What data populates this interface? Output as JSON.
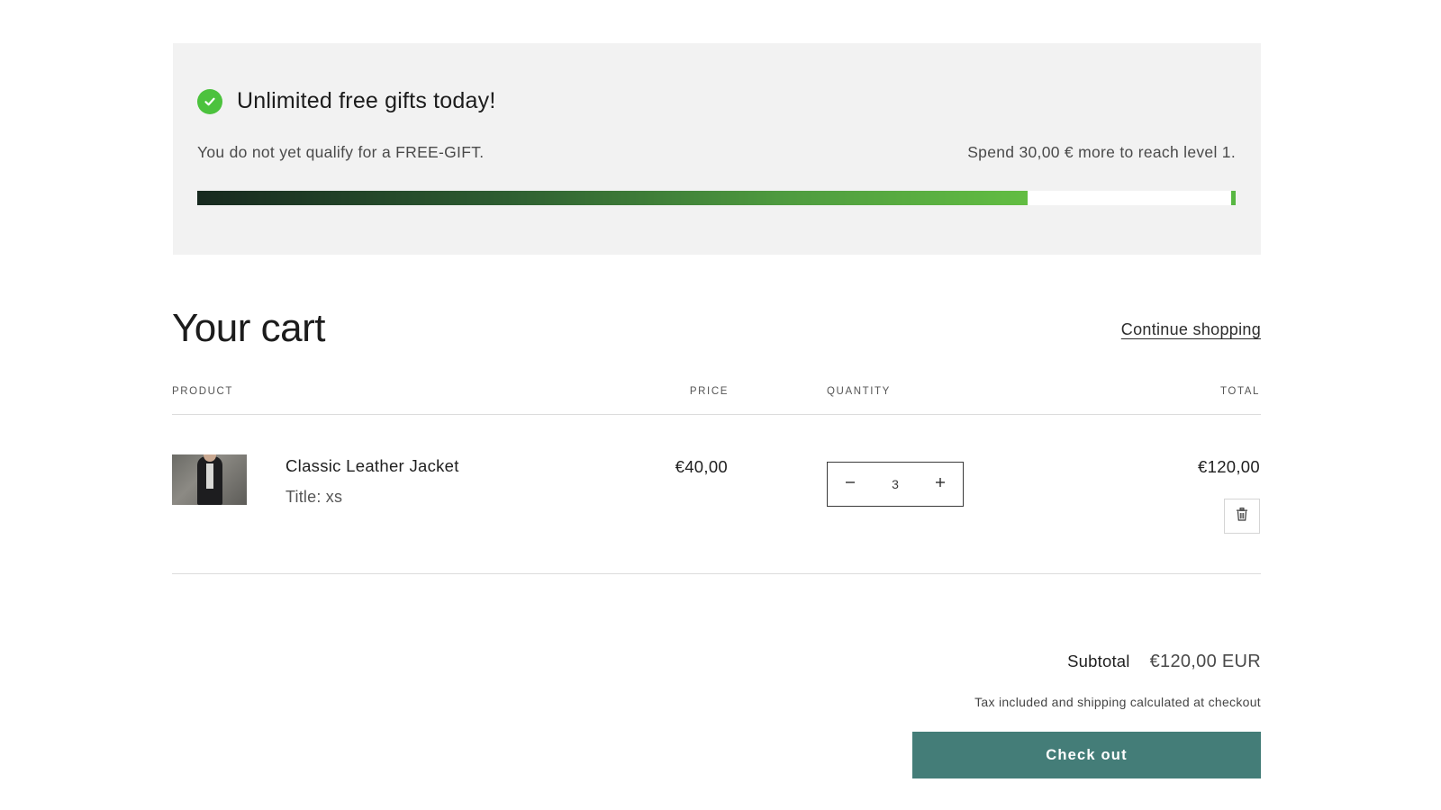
{
  "gift_banner": {
    "title": "Unlimited free gifts today!",
    "status": "You do not yet qualify for a FREE-GIFT.",
    "hint": "Spend 30,00 € more to reach level 1.",
    "progress_fraction": 0.8,
    "icon": "check-circle-icon",
    "accent_color": "#4cc23d"
  },
  "cart": {
    "title": "Your cart",
    "continue_label": "Continue shopping",
    "columns": {
      "product": "PRODUCT",
      "price": "PRICE",
      "quantity": "QUANTITY",
      "total": "TOTAL"
    },
    "items": [
      {
        "name": "Classic Leather Jacket",
        "variant": "Title: xs",
        "price": "€40,00",
        "quantity": "3",
        "total": "€120,00",
        "image": "leather-jacket-photo"
      }
    ]
  },
  "summary": {
    "subtotal_label": "Subtotal",
    "subtotal_value": "€120,00 EUR",
    "tax_note": "Tax included and shipping calculated at checkout",
    "checkout_label": "Check out",
    "checkout_color": "#447d78"
  }
}
